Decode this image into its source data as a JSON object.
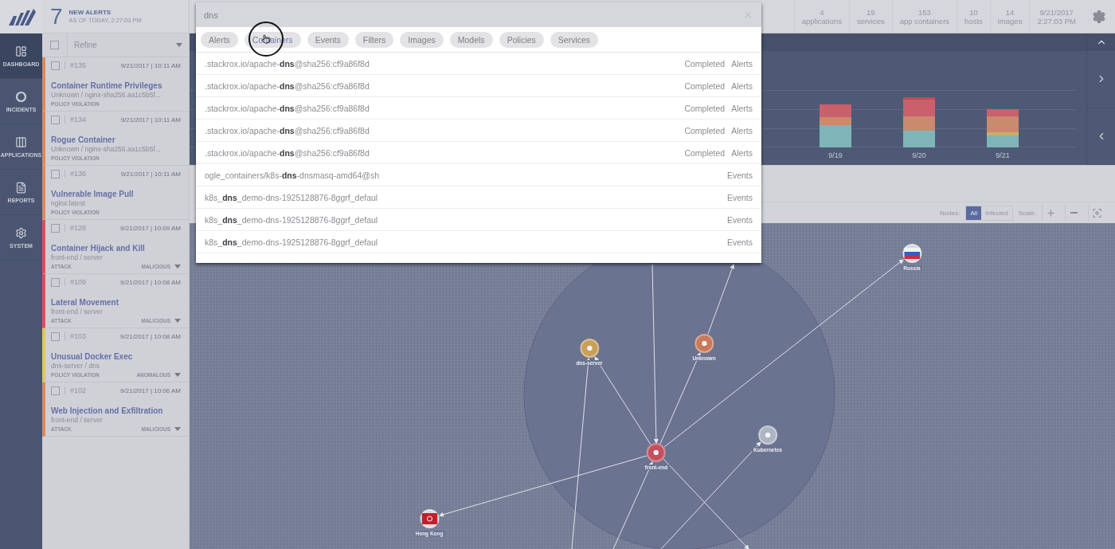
{
  "nav": {
    "items": [
      {
        "label": "DASHBOARD",
        "selected": true
      },
      {
        "label": "INCIDENTS",
        "selected": false
      },
      {
        "label": "APPLICATIONS",
        "selected": false
      },
      {
        "label": "REPORTS",
        "selected": false
      },
      {
        "label": "SYSTEM",
        "selected": false
      }
    ]
  },
  "alerts_header": {
    "count": "7",
    "title": "NEW ALERTS",
    "subtitle": "AS OF TODAY, 2:27:03 PM"
  },
  "refine": {
    "checked": false,
    "label": "Refine"
  },
  "alerts": [
    {
      "id": "#135",
      "date": "9/21/2017 | 10:11 AM",
      "title": "Container Runtime Privileges",
      "subtitle": "Unknown / nginx-sha256.aa1c5b5f...",
      "type": "POLICY VIOLATION",
      "color": "#d98a5c",
      "checked": false
    },
    {
      "id": "#134",
      "date": "9/21/2017 | 10:11 AM",
      "title": "Rogue Container",
      "subtitle": "Unknown / nginx-sha256.aa1c5b5f...",
      "type": "POLICY VIOLATION",
      "color": "#d98a5c",
      "checked": false
    },
    {
      "id": "#136",
      "date": "9/21/2017 | 10:11 AM",
      "title": "Vulnerable Image Pull",
      "subtitle": "nginx:latest",
      "type": "POLICY VIOLATION",
      "color": "#d98a5c",
      "checked": false
    },
    {
      "id": "#128",
      "date": "9/21/2017 | 10:09 AM",
      "title": "Container Hijack and Kill",
      "subtitle": "front-end / server",
      "type": "ATTACK",
      "severity": "MALICIOUS",
      "color": "#d4535f",
      "checked": false
    },
    {
      "id": "#109",
      "date": "9/21/2017 | 10:08 AM",
      "title": "Lateral Movement",
      "subtitle": "front-end / server",
      "type": "ATTACK",
      "severity": "MALICIOUS",
      "color": "#d4535f",
      "checked": false
    },
    {
      "id": "#103",
      "date": "9/21/2017 | 10:08 AM",
      "title": "Unusual Docker Exec",
      "subtitle": "dns-server / dns",
      "type": "POLICY VIOLATION",
      "severity": "ANOMALOUS",
      "color": "#e0c46a",
      "checked": false
    },
    {
      "id": "#102",
      "date": "9/21/2017 | 10:06 AM",
      "title": "Web Injection and Exfiltration",
      "subtitle": "front-end / server",
      "type": "ATTACK",
      "severity": "MALICIOUS",
      "color": "#d98a5c",
      "checked": false
    }
  ],
  "stats": [
    {
      "value": "4",
      "label": "applications"
    },
    {
      "value": "19",
      "label": "services"
    },
    {
      "value": "153",
      "label": "app containers"
    },
    {
      "value": "10",
      "label": "hosts"
    },
    {
      "value": "14",
      "label": "images"
    }
  ],
  "datetime": {
    "date": "9/21/2017",
    "time": "2:27:03 PM"
  },
  "chart": {
    "labels": [
      "9/19",
      "9/20",
      "9/21"
    ]
  },
  "graph_toolbar": {
    "nodes_label": "Nodes:",
    "filters": [
      {
        "label": "All",
        "selected": true
      },
      {
        "label": "Infected",
        "selected": false
      }
    ],
    "scale_label": "Scale:"
  },
  "graph": {
    "nodes": [
      {
        "label": "front-end",
        "kind": "service",
        "color": "#c4505e"
      },
      {
        "label": "dns-server",
        "kind": "service",
        "color": "#c9a05a"
      },
      {
        "label": "Unknown",
        "kind": "service",
        "color": "#c97a5a"
      },
      {
        "label": "Kubernetes",
        "kind": "service",
        "color": "#aeb4c3"
      },
      {
        "label": "Russia",
        "kind": "tricolor"
      },
      {
        "label": "Hong Kong",
        "kind": "starflag"
      }
    ]
  },
  "search": {
    "query": "dns",
    "chips": [
      {
        "label": "Alerts",
        "hovered": false
      },
      {
        "label": "Containers",
        "hovered": true
      },
      {
        "label": "Events",
        "hovered": false
      },
      {
        "label": "Filters",
        "hovered": false
      },
      {
        "label": "Images",
        "hovered": false
      },
      {
        "label": "Models",
        "hovered": false
      },
      {
        "label": "Policies",
        "hovered": false
      },
      {
        "label": "Services",
        "hovered": false
      }
    ],
    "results": [
      {
        "text": ".stackrox.io/apache-**dns**@sha256:cf9a86f8d",
        "status": "Completed",
        "category": "Alerts"
      },
      {
        "text": ".stackrox.io/apache-**dns**@sha256:cf9a86f8d",
        "status": "Completed",
        "category": "Alerts"
      },
      {
        "text": ".stackrox.io/apache-**dns**@sha256:cf9a86f8d",
        "status": "Completed",
        "category": "Alerts"
      },
      {
        "text": ".stackrox.io/apache-**dns**@sha256:cf9a86f8d",
        "status": "Completed",
        "category": "Alerts"
      },
      {
        "text": ".stackrox.io/apache-**dns**@sha256:cf9a86f8d",
        "status": "Completed",
        "category": "Alerts"
      },
      {
        "text": "ogle_containers/k8s-**dns**-dnsmasq-amd64@sh",
        "category": "Events"
      },
      {
        "text": "k8s_**dns**_demo-dns-1925128876-8ggrf_defaul",
        "category": "Events"
      },
      {
        "text": "k8s_**dns**_demo-dns-1925128876-8ggrf_defaul",
        "category": "Events"
      },
      {
        "text": "k8s_**dns**_demo-dns-1925128876-8ggrf_defaul",
        "category": "Events"
      }
    ]
  }
}
